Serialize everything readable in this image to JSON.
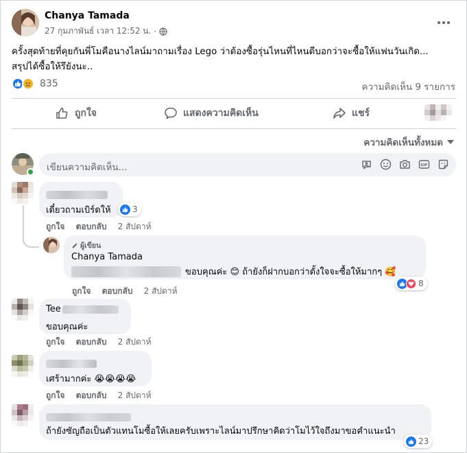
{
  "post": {
    "author": "Chanya Tamada",
    "date": "27 กุมภาพันธ์ เวลา 12:52 น.",
    "separator": "·",
    "text_line1": "ครั้งสุดท้ายที่คุยกันพี่โมคือนางไลน์มาถามเรื่อง Lego ว่าต้องซื้อรุ่นไหนที่ไหนดีบอกว่าจะซื้อให้แฟนวันเกิด...",
    "text_line2": "สรุปได้ซื้อให้รึยังนะ..",
    "reaction_count": "835",
    "comment_count": "ความคิดเห็น 9 รายการ",
    "more_icon": "ellipsis-icon"
  },
  "actions": {
    "like": "ถูกใจ",
    "comment": "แสดงความคิดเห็น",
    "share": "แชร์"
  },
  "filter": {
    "label": "ความคิดเห็นทั้งหมด"
  },
  "composer": {
    "placeholder": "เขียนความคิดเห็น..."
  },
  "comments": [
    {
      "text": "เดี๋ยวถามเบิร์ดให้",
      "reactions": "3",
      "like": "ถูกใจ",
      "reply": "ตอบกลับ",
      "time": "2 สัปดาห์"
    },
    {
      "badge": "ผู้เขียน",
      "author": "Chanya Tamada",
      "text": "ขอบคุณค่ะ 😊 ถ้ายังก็ฝากบอกว่าตั้งใจจะซื้อให้มากๆ 🥰",
      "reactions": "8",
      "like": "ถูกใจ",
      "reply": "ตอบกลับ",
      "time": "2 สัปดาห์"
    },
    {
      "author_partial": "Tee",
      "text": "ขอบคุณค่ะ",
      "like": "ถูกใจ",
      "reply": "ตอบกลับ",
      "time": "2 สัปดาห์"
    },
    {
      "text": "เศร้ามากค่ะ 😭😭😭😭",
      "like": "ถูกใจ",
      "reply": "ตอบกลับ",
      "time": "2 สัปดาห์"
    },
    {
      "text": "ถ้ายังซัญถือเป็นตัวแทนโมซื้อให้เลยครับเพราะไลน์มาปรึกษาคิดว่าโมไว้ใจถึงมาขอคำแนะนำ",
      "reactions": "23"
    }
  ],
  "colors": {
    "accent": "#1877f2",
    "secondary_text": "#65676b",
    "bubble": "#f0f2f5",
    "divider": "#ced0d4",
    "online": "#31a24c"
  }
}
